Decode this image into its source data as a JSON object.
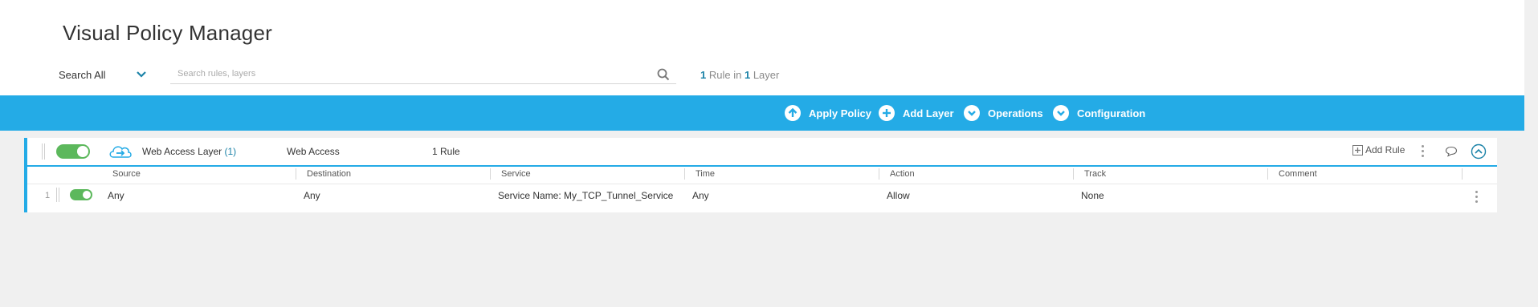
{
  "app": {
    "title": "Visual Policy Manager"
  },
  "search": {
    "scope": "Search All",
    "placeholder": "Search rules, layers",
    "value": ""
  },
  "summary": {
    "rule_count": "1",
    "rule_word": "Rule in",
    "layer_count": "1",
    "layer_word": "Layer"
  },
  "toolbar": {
    "apply_policy": "Apply Policy",
    "add_layer": "Add Layer",
    "operations": "Operations",
    "configuration": "Configuration"
  },
  "layer": {
    "name": "Web Access Layer",
    "count_label": "(1)",
    "type": "Web Access",
    "rules_label": "1 Rule",
    "add_rule": "Add Rule",
    "enabled": true
  },
  "columns": [
    "Source",
    "Destination",
    "Service",
    "Time",
    "Action",
    "Track",
    "Comment"
  ],
  "rows": [
    {
      "number": "1",
      "enabled": true,
      "source": "Any",
      "destination": "Any",
      "service": "Service Name: My_TCP_Tunnel_Service",
      "time": "Any",
      "action": "Allow",
      "track": "None",
      "comment": ""
    }
  ],
  "colors": {
    "accent": "#24abe6",
    "toggle_on": "#5cb85c",
    "count_blue": "#1c83a8"
  }
}
